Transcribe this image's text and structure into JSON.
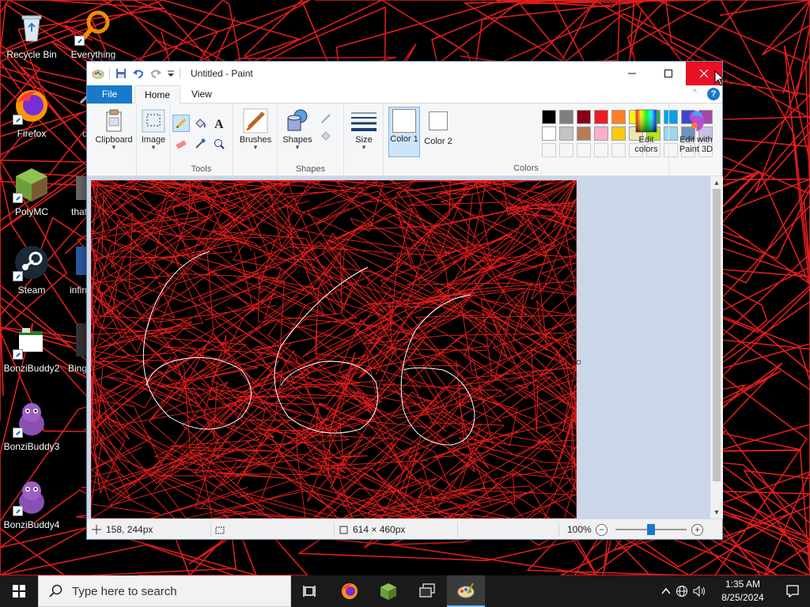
{
  "desktop": {
    "icons": [
      {
        "label": "Recycle Bin"
      },
      {
        "label": "Everything"
      },
      {
        "label": "Firefox"
      },
      {
        "label": "c"
      },
      {
        "label": "PolyMC"
      },
      {
        "label": "that"
      },
      {
        "label": "Steam"
      },
      {
        "label": "infin"
      },
      {
        "label": "BonziBuddy2"
      },
      {
        "label": "Bing"
      },
      {
        "label": "BonziBuddy3"
      },
      {
        "label": "BonziBuddy4"
      }
    ],
    "scribble_color": "#e11d1d"
  },
  "paint": {
    "title": "Untitled - Paint",
    "tabs": {
      "file": "File",
      "home": "Home",
      "view": "View"
    },
    "groups": {
      "clipboard": "Clipboard",
      "image": "Image",
      "tools": "Tools",
      "brushes": "Brushes",
      "shapes_btn": "Shapes",
      "shapes": "Shapes",
      "size": "Size",
      "color1": "Color 1",
      "color2": "Color 2",
      "edit_colors": "Edit colors",
      "edit_paint3d": "Edit with Paint 3D",
      "colors": "Colors"
    },
    "palette_row1": [
      "#000000",
      "#7f7f7f",
      "#880015",
      "#ed1c24",
      "#ff7f27",
      "#fff200",
      "#22b14c",
      "#00a2e8",
      "#3f48cc",
      "#a349a4"
    ],
    "palette_row2": [
      "#ffffff",
      "#c3c3c3",
      "#b97a57",
      "#ffaec9",
      "#ffc90e",
      "#efe4b0",
      "#b5e61d",
      "#99d9ea",
      "#7092be",
      "#c8bfe7"
    ],
    "color1_value": "#ffffff",
    "color2_value": "#ffffff",
    "status": {
      "cursor_pos": "158, 244px",
      "image_size": "614 × 460px",
      "zoom": "100%",
      "zoom_level": 50
    }
  },
  "taskbar": {
    "search_placeholder": "Type here to search",
    "time": "1:35 AM",
    "date": "8/25/2024"
  }
}
